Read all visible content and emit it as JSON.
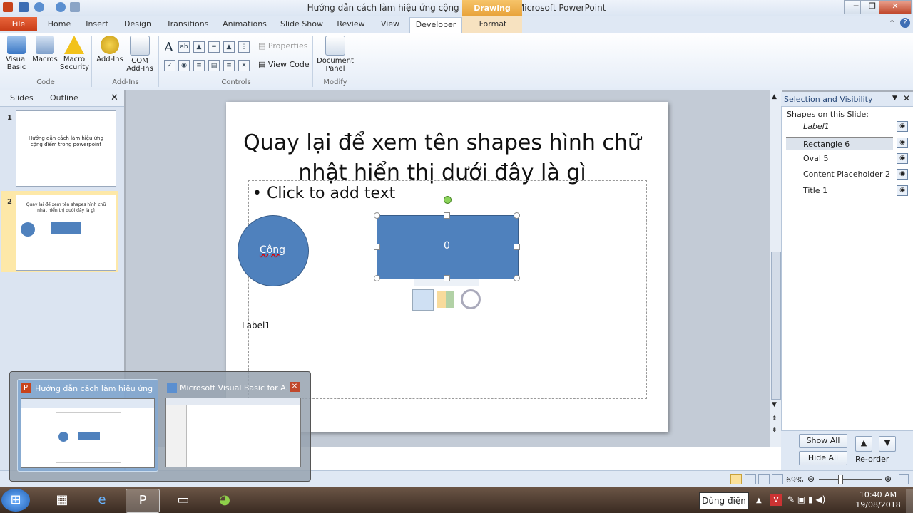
{
  "window": {
    "title": "Hướng dẫn cách làm hiệu ứng cộng điểm.pptm - Microsoft PowerPoint",
    "drawing_tools": "Drawing Tools"
  },
  "tabs": [
    "File",
    "Home",
    "Insert",
    "Design",
    "Transitions",
    "Animations",
    "Slide Show",
    "Review",
    "View",
    "Developer",
    "Format"
  ],
  "ribbon": {
    "code": {
      "visual_basic": "Visual\nBasic",
      "visual_basic_1": "Visual",
      "visual_basic_2": "Basic",
      "macros": "Macros",
      "macro_security_1": "Macro",
      "macro_security_2": "Security",
      "group": "Code"
    },
    "addins": {
      "addins": "Add-Ins",
      "com_1": "COM",
      "com_2": "Add-Ins",
      "group": "Add-Ins"
    },
    "controls": {
      "properties": "Properties",
      "view_code": "View Code",
      "group": "Controls"
    },
    "modify": {
      "doc_1": "Document",
      "doc_2": "Panel",
      "group": "Modify"
    }
  },
  "left_pane": {
    "tab_slides": "Slides",
    "tab_outline": "Outline",
    "slide1_num": "1",
    "slide1_text": "Hướng dẫn cách làm hiệu ứng cộng điểm trong powerpoint",
    "slide2_num": "2",
    "slide2_text": "Quay lại để xem tên shapes hình chữ nhật hiển thị dưới đây là gì"
  },
  "slide": {
    "title": "Quay lại để xem tên shapes hình chữ nhật hiển thị dưới đây là gì",
    "bullet": "Click to add text",
    "oval_text": "Cộng",
    "rect_text": "0",
    "label": "Label1"
  },
  "selection_pane": {
    "title": "Selection and Visibility",
    "subtitle": "Shapes on this Slide:",
    "items": [
      "Label1",
      "Rectangle 6",
      "Oval 5",
      "Content Placeholder 2",
      "Title 1"
    ],
    "show_all": "Show All",
    "hide_all": "Hide All",
    "reorder": "Re-order"
  },
  "status": {
    "zoom": "69%"
  },
  "taskbar_preview": {
    "item1": "Hướng dẫn cách làm hiệu ứng ...",
    "item2": "Microsoft Visual Basic for A..."
  },
  "tooltip": "Dùng điện",
  "clock": {
    "time": "10:40 AM",
    "date": "19/08/2018"
  }
}
